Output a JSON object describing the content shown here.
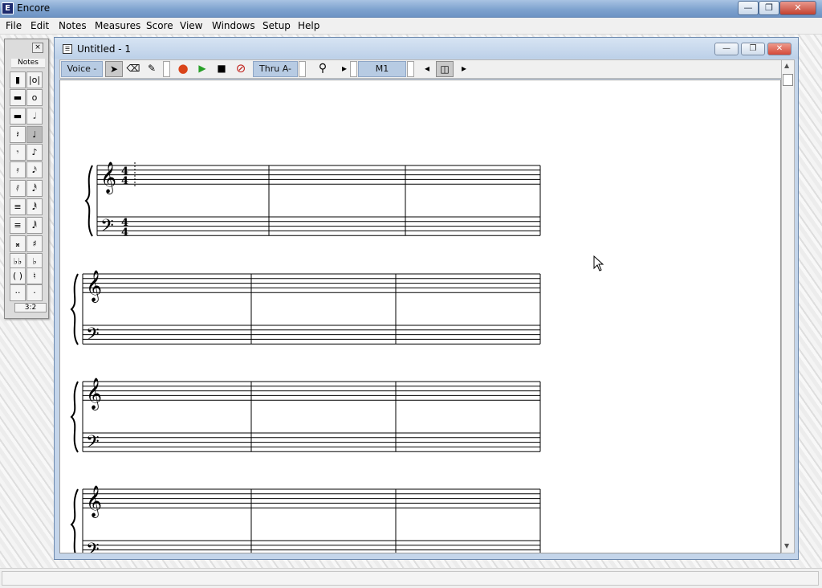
{
  "app": {
    "title": "Encore",
    "icon": "encore-app-icon"
  },
  "menus": [
    "File",
    "Edit",
    "Notes",
    "Measures",
    "Score",
    "View",
    "Windows",
    "Setup",
    "Help"
  ],
  "palette": {
    "title": "Notes",
    "close": "×",
    "tuplet": "3:2",
    "selected": "quarter-note-button"
  },
  "document": {
    "title": "Untitled - 1",
    "toolbar": {
      "voice": "Voice -",
      "thru": "Thru A-",
      "measure": "M1"
    }
  },
  "score": {
    "time_signature": {
      "top": "4",
      "bottom": "4"
    },
    "systems": 4,
    "measures_per_system": 3
  },
  "colors": {
    "titlebar": "#7fa3cf",
    "toolbar_label": "#b7cbe3",
    "record": "#d9441a",
    "play": "#28a028",
    "close_button": "#d44a3a"
  }
}
